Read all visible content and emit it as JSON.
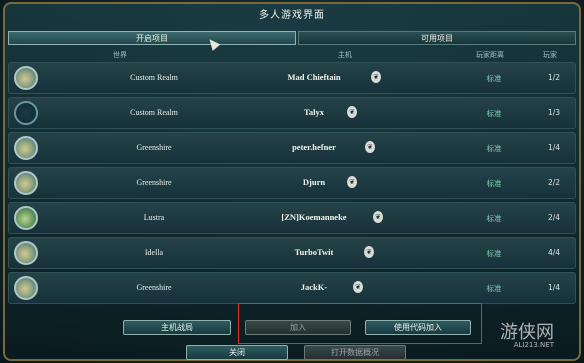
{
  "window": {
    "title": "多人游戏界面"
  },
  "tabs": [
    {
      "label": "开启项目",
      "active": true
    },
    {
      "label": "可用项目",
      "active": false
    }
  ],
  "columns": {
    "world": "世界",
    "host": "主机",
    "distance": "玩家距离",
    "players": "玩家"
  },
  "rows": [
    {
      "world": "Custom Realm",
      "host": "Mad Chieftain",
      "distance": "标准",
      "players": "1/2",
      "avatar": "continent"
    },
    {
      "world": "Custom Realm",
      "host": "Talyx",
      "distance": "标准",
      "players": "1/3",
      "avatar": "empty"
    },
    {
      "world": "Greenshire",
      "host": "peter.hefner",
      "distance": "标准",
      "players": "1/4",
      "avatar": "continent"
    },
    {
      "world": "Greenshire",
      "host": "Djurn",
      "distance": "标准",
      "players": "2/2",
      "avatar": "continent"
    },
    {
      "world": "Lustra",
      "host": "[ZN]Koemanneke",
      "distance": "标准",
      "players": "2/4",
      "avatar": "green"
    },
    {
      "world": "Idella",
      "host": "TurboTwit",
      "distance": "标准",
      "players": "4/4",
      "avatar": "continent"
    },
    {
      "world": "Greenshire",
      "host": "JackK-",
      "distance": "标准",
      "players": "1/4",
      "avatar": "continent"
    }
  ],
  "buttons": {
    "host_battle": "主机战局",
    "join": "加入",
    "join_with_code": "使用代码加入",
    "close": "关闭",
    "open_data_overview": "打开数据概况"
  },
  "watermark": {
    "main": "游侠网",
    "sub": "ALI213.NET"
  },
  "colors": {
    "accent": "#7fd1b4",
    "highlight_box": "#e0302c",
    "frame": "#7a6a3a"
  }
}
